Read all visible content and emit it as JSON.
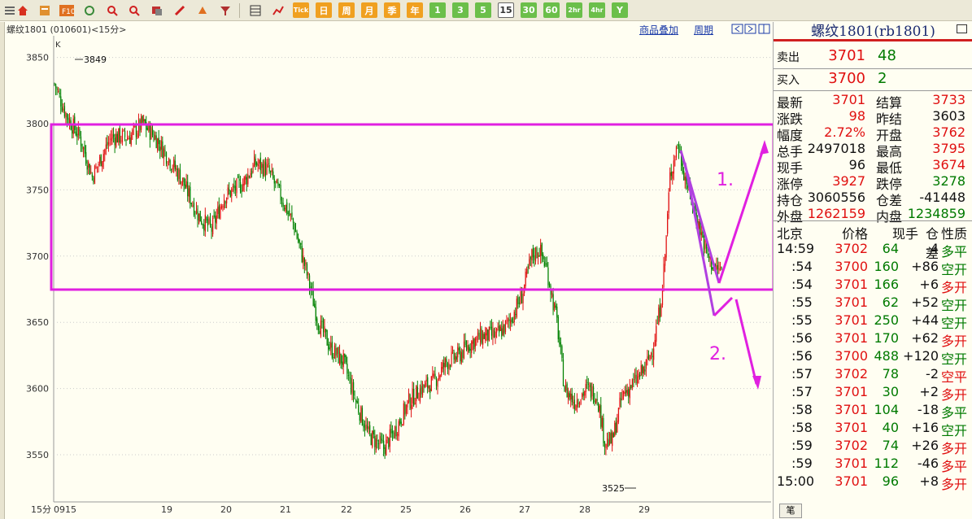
{
  "toolbar": {
    "period_buttons": [
      "日",
      "周",
      "月",
      "季",
      "年",
      "1",
      "3",
      "5",
      "15",
      "30",
      "60",
      "2hr",
      "4hr",
      "Y"
    ],
    "selected_period": "15",
    "tick_label": "Tick"
  },
  "chart_header": {
    "title": "螺纹1801 (010601)<15分>",
    "overlay_link": "商品叠加",
    "period_link": "周期",
    "k_label": "K"
  },
  "chart_data": {
    "type": "candlestick",
    "ylim": [
      3520,
      3860
    ],
    "yticks": [
      3850,
      3800,
      3750,
      3700,
      3650,
      3600,
      3550
    ],
    "period_label": "15分",
    "x_labels": [
      "0915",
      "19",
      "20",
      "21",
      "22",
      "25",
      "26",
      "27",
      "28",
      "29"
    ],
    "high_annotation": "3849",
    "low_annotation": "3525",
    "annotations": [
      "1.",
      "2."
    ],
    "colors": {
      "up": "#e01010",
      "down": "#008000",
      "box": "#e020e0",
      "grid": "#cccccc"
    },
    "close_path": [
      [
        0,
        3830
      ],
      [
        10,
        3805
      ],
      [
        20,
        3790
      ],
      [
        30,
        3760
      ],
      [
        45,
        3790
      ],
      [
        60,
        3790
      ],
      [
        70,
        3800
      ],
      [
        80,
        3790
      ],
      [
        90,
        3775
      ],
      [
        100,
        3760
      ],
      [
        115,
        3730
      ],
      [
        125,
        3720
      ],
      [
        135,
        3745
      ],
      [
        150,
        3755
      ],
      [
        160,
        3770
      ],
      [
        170,
        3765
      ],
      [
        180,
        3745
      ],
      [
        190,
        3725
      ],
      [
        200,
        3690
      ],
      [
        210,
        3650
      ],
      [
        220,
        3630
      ],
      [
        230,
        3620
      ],
      [
        240,
        3590
      ],
      [
        250,
        3565
      ],
      [
        262,
        3555
      ],
      [
        272,
        3570
      ],
      [
        282,
        3590
      ],
      [
        292,
        3600
      ],
      [
        302,
        3605
      ],
      [
        312,
        3620
      ],
      [
        322,
        3625
      ],
      [
        332,
        3635
      ],
      [
        342,
        3640
      ],
      [
        352,
        3640
      ],
      [
        362,
        3650
      ],
      [
        372,
        3670
      ],
      [
        380,
        3700
      ],
      [
        386,
        3705
      ],
      [
        392,
        3690
      ],
      [
        400,
        3650
      ],
      [
        406,
        3600
      ],
      [
        414,
        3590
      ],
      [
        424,
        3600
      ],
      [
        432,
        3595
      ],
      [
        438,
        3560
      ],
      [
        444,
        3560
      ],
      [
        452,
        3595
      ],
      [
        462,
        3605
      ],
      [
        470,
        3615
      ],
      [
        476,
        3630
      ],
      [
        482,
        3660
      ],
      [
        486,
        3700
      ],
      [
        490,
        3760
      ],
      [
        496,
        3785
      ],
      [
        502,
        3760
      ],
      [
        508,
        3740
      ],
      [
        514,
        3720
      ],
      [
        520,
        3700
      ],
      [
        526,
        3690
      ],
      [
        531,
        3690
      ]
    ]
  },
  "quote_panel": {
    "title": "螺纹1801(rb1801)",
    "sell_label": "卖出",
    "sell_price": "3701",
    "sell_qty": "48",
    "buy_label": "买入",
    "buy_price": "3700",
    "buy_qty": "2",
    "stats": [
      {
        "l1": "最新",
        "v1": "3701",
        "c1": "red",
        "l2": "结算",
        "v2": "3733",
        "c2": "red"
      },
      {
        "l1": "涨跌",
        "v1": "98",
        "c1": "red",
        "l2": "昨结",
        "v2": "3603",
        "c2": "blk"
      },
      {
        "l1": "幅度",
        "v1": "2.72%",
        "c1": "red",
        "l2": "开盘",
        "v2": "3762",
        "c2": "red"
      },
      {
        "l1": "总手",
        "v1": "2497018",
        "c1": "blk",
        "l2": "最高",
        "v2": "3795",
        "c2": "red"
      },
      {
        "l1": "现手",
        "v1": "96",
        "c1": "blk",
        "l2": "最低",
        "v2": "3674",
        "c2": "red"
      },
      {
        "l1": "涨停",
        "v1": "3927",
        "c1": "red",
        "l2": "跌停",
        "v2": "3278",
        "c2": "grn"
      },
      {
        "l1": "持仓",
        "v1": "3060556",
        "c1": "blk",
        "l2": "仓差",
        "v2": "-41448",
        "c2": "blk"
      },
      {
        "l1": "外盘",
        "v1": "1262159",
        "c1": "red",
        "l2": "内盘",
        "v2": "1234859",
        "c2": "grn"
      }
    ],
    "trades_header": [
      "北京",
      "价格",
      "现手",
      "仓差",
      "性质"
    ],
    "trades": [
      {
        "time": "14:59",
        "price": "3702",
        "pc": "red",
        "vol": "64",
        "oi": "-4",
        "nature": "多平",
        "nc": "grn"
      },
      {
        "time": ":54",
        "price": "3700",
        "pc": "red",
        "vol": "160",
        "oi": "+86",
        "nature": "空开",
        "nc": "grn"
      },
      {
        "time": ":54",
        "price": "3701",
        "pc": "red",
        "vol": "166",
        "oi": "+6",
        "nature": "多开",
        "nc": "red"
      },
      {
        "time": ":55",
        "price": "3701",
        "pc": "red",
        "vol": "62",
        "oi": "+52",
        "nature": "空开",
        "nc": "grn"
      },
      {
        "time": ":55",
        "price": "3701",
        "pc": "red",
        "vol": "250",
        "oi": "+44",
        "nature": "空开",
        "nc": "grn"
      },
      {
        "time": ":56",
        "price": "3701",
        "pc": "red",
        "vol": "170",
        "oi": "+62",
        "nature": "多开",
        "nc": "red"
      },
      {
        "time": ":56",
        "price": "3700",
        "pc": "red",
        "vol": "488",
        "oi": "+120",
        "nature": "空开",
        "nc": "grn"
      },
      {
        "time": ":57",
        "price": "3702",
        "pc": "red",
        "vol": "78",
        "oi": "-2",
        "nature": "空平",
        "nc": "red"
      },
      {
        "time": ":57",
        "price": "3701",
        "pc": "red",
        "vol": "30",
        "oi": "+2",
        "nature": "多开",
        "nc": "red"
      },
      {
        "time": ":58",
        "price": "3701",
        "pc": "red",
        "vol": "104",
        "oi": "-18",
        "nature": "多平",
        "nc": "grn"
      },
      {
        "time": ":58",
        "price": "3701",
        "pc": "red",
        "vol": "40",
        "oi": "+16",
        "nature": "空开",
        "nc": "grn"
      },
      {
        "time": ":59",
        "price": "3702",
        "pc": "red",
        "vol": "74",
        "oi": "+26",
        "nature": "多开",
        "nc": "red"
      },
      {
        "time": ":59",
        "price": "3701",
        "pc": "red",
        "vol": "112",
        "oi": "-46",
        "nature": "多平",
        "nc": "red"
      },
      {
        "time": "15:00",
        "price": "3701",
        "pc": "red",
        "vol": "96",
        "oi": "+8",
        "nature": "多开",
        "nc": "red"
      }
    ],
    "bottom_tab": "笔"
  }
}
